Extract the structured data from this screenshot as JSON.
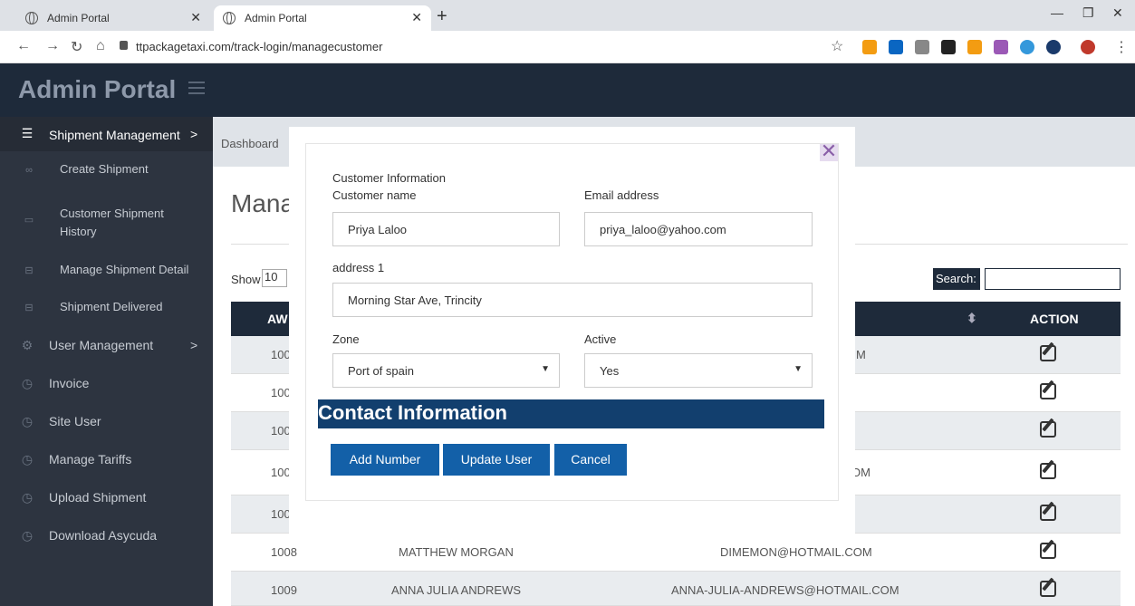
{
  "browser": {
    "tabs": [
      {
        "title": "Admin Portal"
      },
      {
        "title": "Admin Portal"
      }
    ],
    "url": "ttpackagetaxi.com/track-login/managecustomer"
  },
  "app": {
    "brand": "Admin Portal"
  },
  "sidebar": {
    "items": [
      {
        "label": "Shipment Management",
        "icon": "database-icon",
        "arrow": ">"
      },
      {
        "label": "Create Shipment",
        "icon": "infinity-icon"
      },
      {
        "label": "Customer Shipment History",
        "icon": "monitor-icon"
      },
      {
        "label": "Manage Shipment Detail",
        "icon": "drive-icon"
      },
      {
        "label": "Shipment Delivered",
        "icon": "drive-icon"
      },
      {
        "label": "User Management",
        "icon": "gear-icon",
        "arrow": ">"
      },
      {
        "label": "Invoice",
        "icon": "clock-icon"
      },
      {
        "label": "Site User",
        "icon": "clock-icon"
      },
      {
        "label": "Manage Tariffs",
        "icon": "clock-icon"
      },
      {
        "label": "Upload Shipment",
        "icon": "clock-icon"
      },
      {
        "label": "Download Asycuda",
        "icon": "clock-icon"
      }
    ]
  },
  "main": {
    "breadcrumb": "Dashboard",
    "page_title": "Mana",
    "show_label": "Show",
    "show_value": "10",
    "search_label": "Search:",
    "columns": {
      "awb": "AW",
      "action": "ACTION"
    },
    "rows": [
      {
        "awb": "100",
        "name": "",
        "email": "M"
      },
      {
        "awb": "100",
        "name": "",
        "email": ""
      },
      {
        "awb": "100",
        "name": "",
        "email": ""
      },
      {
        "awb": "100",
        "name": "",
        "email": "OM"
      },
      {
        "awb": "100",
        "name": "",
        "email": ""
      },
      {
        "awb": "1008",
        "name": "MATTHEW MORGAN",
        "email": "DIMEMON@HOTMAIL.COM"
      },
      {
        "awb": "1009",
        "name": "ANNA JULIA ANDREWS",
        "email": "ANNA-JULIA-ANDREWS@HOTMAIL.COM"
      }
    ]
  },
  "modal": {
    "section_title": "Customer Information",
    "customer_name_label": "Customer name",
    "customer_name": "Priya Laloo",
    "email_label": "Email address",
    "email": "priya_laloo@yahoo.com",
    "address_label": "address 1",
    "address": "Morning Star Ave, Trincity",
    "zone_label": "Zone",
    "zone": "Port of spain",
    "active_label": "Active",
    "active": "Yes",
    "contact_title": "Contact Information",
    "buttons": {
      "add": "Add Number",
      "update": "Update User",
      "cancel": "Cancel"
    }
  },
  "colors": {
    "navy": "#1e2a3a",
    "sidebar": "#2d3440",
    "button": "#1360a8",
    "contact_bar": "#123f6e"
  }
}
